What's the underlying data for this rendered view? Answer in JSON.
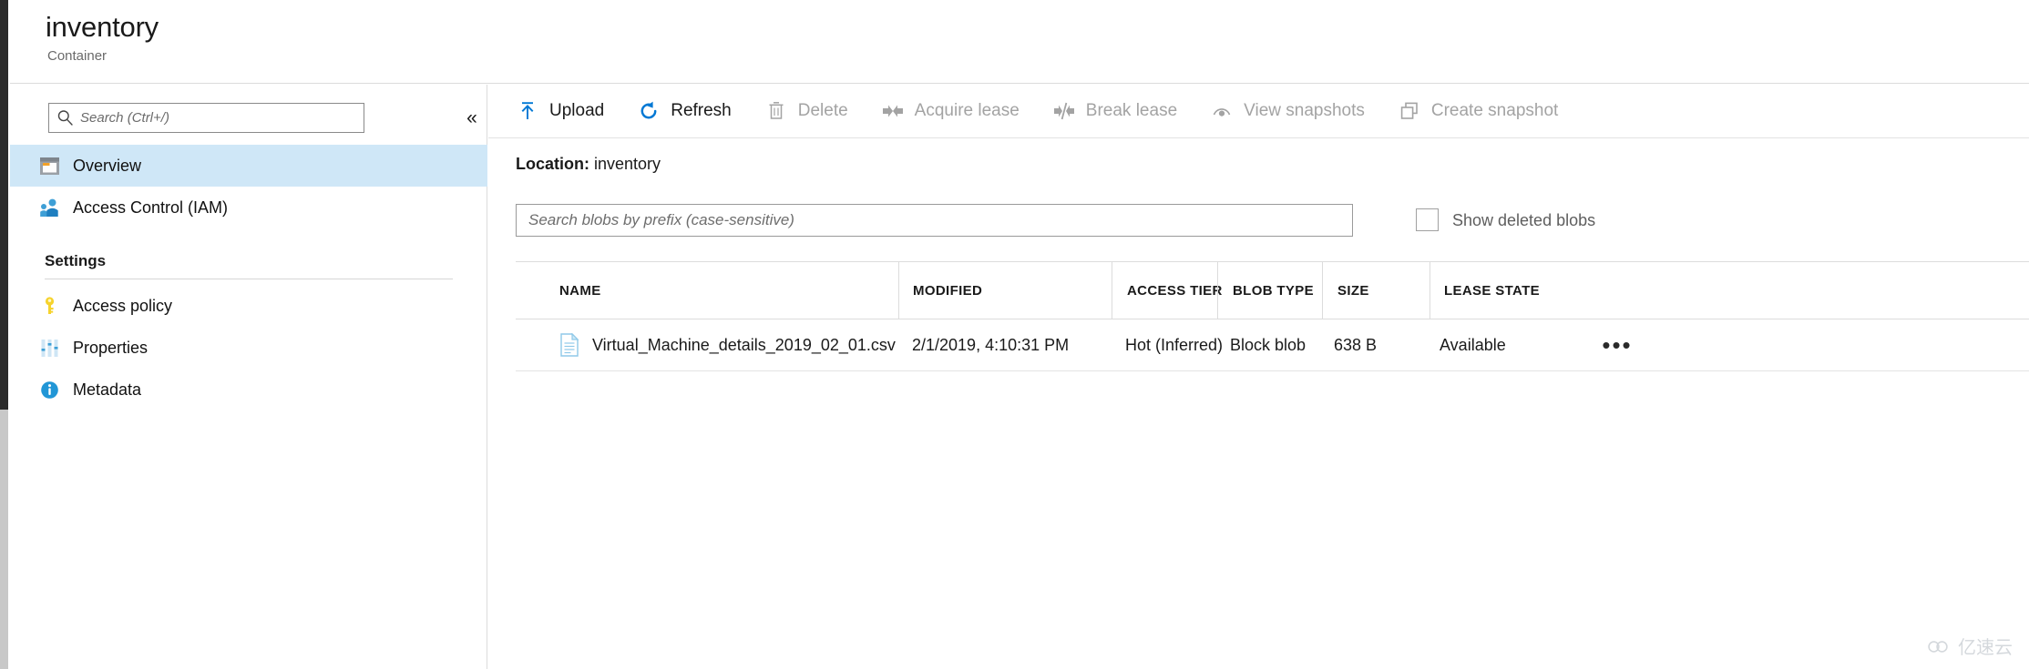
{
  "blade": {
    "title": "inventory",
    "subtitle": "Container"
  },
  "sidebar": {
    "search": {
      "placeholder": "Search (Ctrl+/)",
      "value": ""
    },
    "collapse_glyph": "«",
    "items": [
      {
        "label": "Overview",
        "icon": "overview-icon",
        "selected": true
      },
      {
        "label": "Access Control (IAM)",
        "icon": "people-icon",
        "selected": false
      }
    ],
    "sections": [
      {
        "title": "Settings",
        "items": [
          {
            "label": "Access policy",
            "icon": "key-icon"
          },
          {
            "label": "Properties",
            "icon": "sliders-icon"
          },
          {
            "label": "Metadata",
            "icon": "info-icon"
          }
        ]
      }
    ]
  },
  "toolbar": {
    "buttons": [
      {
        "label": "Upload",
        "icon": "upload-icon",
        "enabled": true
      },
      {
        "label": "Refresh",
        "icon": "refresh-icon",
        "enabled": true
      },
      {
        "label": "Delete",
        "icon": "trash-icon",
        "enabled": false
      },
      {
        "label": "Acquire lease",
        "icon": "acquire-lease-icon",
        "enabled": false
      },
      {
        "label": "Break lease",
        "icon": "break-lease-icon",
        "enabled": false
      },
      {
        "label": "View snapshots",
        "icon": "view-snapshots-icon",
        "enabled": false
      },
      {
        "label": "Create snapshot",
        "icon": "create-snapshot-icon",
        "enabled": false
      }
    ]
  },
  "location": {
    "label": "Location:",
    "value": "inventory"
  },
  "blob_search": {
    "placeholder": "Search blobs by prefix (case-sensitive)",
    "value": ""
  },
  "show_deleted": {
    "label": "Show deleted blobs",
    "checked": false
  },
  "table": {
    "columns": [
      "NAME",
      "MODIFIED",
      "ACCESS TIER",
      "BLOB TYPE",
      "SIZE",
      "LEASE STATE"
    ],
    "rows": [
      {
        "name": "Virtual_Machine_details_2019_02_01.csv",
        "modified": "2/1/2019, 4:10:31 PM",
        "access_tier": "Hot (Inferred)",
        "blob_type": "Block blob",
        "size": "638 B",
        "lease_state": "Available",
        "menu_glyph": "•••"
      }
    ]
  },
  "watermark": {
    "text": "亿速云"
  },
  "colors": {
    "accent": "#0078d4",
    "selected_row": "#cfe7f7",
    "disabled_text": "#a3a3a3",
    "border": "#dcdcdc"
  }
}
